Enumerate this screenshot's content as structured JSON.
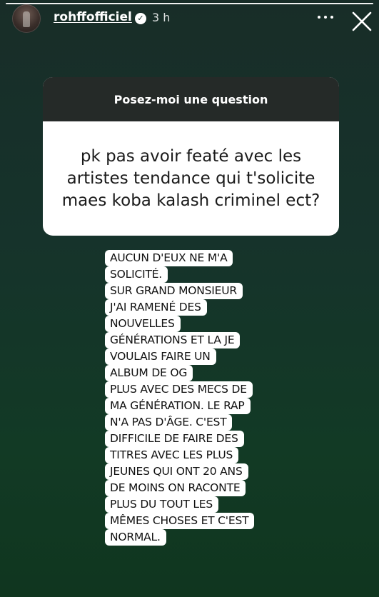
{
  "story": {
    "progress": 1.0,
    "username": "rohffofficiel",
    "verified_icon": "verified-badge-icon",
    "time": "3 h",
    "more_icon": "more-dots-icon",
    "close_icon": "close-icon"
  },
  "question_sticker": {
    "title": "Posez-moi une question",
    "question": "pk pas avoir featé avec les artistes tendance qui t'solicite maes koba kalash criminel ect?"
  },
  "answer_lines": [
    "AUCUN D'EUX NE M'A",
    "SOLICITÉ.",
    "SUR GRAND MONSIEUR",
    "J'AI RAMENÉ DES",
    "NOUVELLES",
    "GÉNÉRATIONS ET LA JE",
    "VOULAIS FAIRE UN",
    "ALBUM DE OG",
    "PLUS AVEC DES MECS DE",
    "MA GÉNÉRATION. LE RAP",
    "N'A PAS D'ÂGE. C'EST",
    "DIFFICILE DE FAIRE DES",
    "TITRES AVEC LES PLUS",
    "JEUNES QUI ONT 20 ANS",
    "DE MOINS ON RACONTE",
    "PLUS DU TOUT LES",
    "MÊMES CHOSES ET C'EST",
    "NORMAL."
  ],
  "colors": {
    "background_top": "#182d28",
    "background_bottom": "#10361f",
    "sticker_header": "#252a28",
    "text_highlight": "#ffffff"
  }
}
